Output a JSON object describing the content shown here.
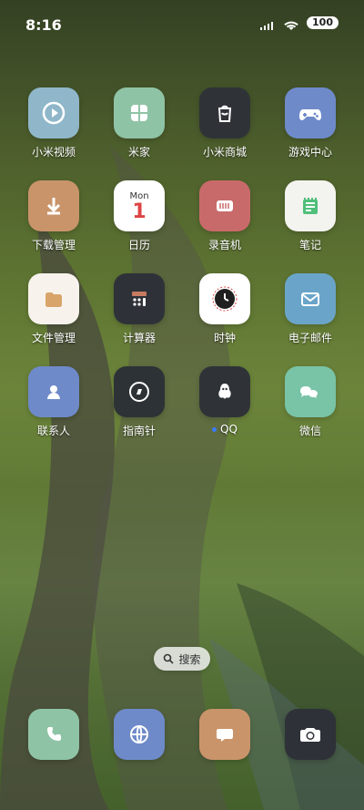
{
  "status_bar": {
    "time": "8:16",
    "battery": "100",
    "icons": [
      "signal-icon",
      "wifi-icon",
      "battery-icon"
    ]
  },
  "apps": [
    {
      "label": "小米视频",
      "icon": "play-icon",
      "color": "#8fb7c9"
    },
    {
      "label": "米家",
      "icon": "home-grid-icon",
      "color": "#8fc3a6"
    },
    {
      "label": "小米商城",
      "icon": "shopping-bag-icon",
      "color": "#2f3338"
    },
    {
      "label": "游戏中心",
      "icon": "gamepad-icon",
      "color": "#6e8ac9"
    },
    {
      "label": "下载管理",
      "icon": "download-icon",
      "color": "#c9946a"
    },
    {
      "label": "日历",
      "icon": "calendar-icon",
      "color": "#ffffff",
      "calendar_day": "Mon",
      "calendar_date": "1"
    },
    {
      "label": "录音机",
      "icon": "recorder-icon",
      "color": "#c96a6a"
    },
    {
      "label": "笔记",
      "icon": "notes-icon",
      "color": "#f3f3ef"
    },
    {
      "label": "文件管理",
      "icon": "folder-icon",
      "color": "#f7f3ec"
    },
    {
      "label": "计算器",
      "icon": "calculator-icon",
      "color": "#2e3238"
    },
    {
      "label": "时钟",
      "icon": "clock-icon",
      "color": "#ffffff"
    },
    {
      "label": "电子邮件",
      "icon": "mail-icon",
      "color": "#6aa5c9"
    },
    {
      "label": "联系人",
      "icon": "contact-icon",
      "color": "#6f8ac9"
    },
    {
      "label": "指南针",
      "icon": "compass-icon",
      "color": "#2d3236"
    },
    {
      "label": "QQ",
      "icon": "penguin-icon",
      "color": "#2f3338",
      "badge_dot": true
    },
    {
      "label": "微信",
      "icon": "chat-bubbles-icon",
      "color": "#79c3a6"
    }
  ],
  "search_label": "搜索",
  "dock": [
    {
      "name": "phone",
      "icon": "phone-icon",
      "color": "#8fc3a6"
    },
    {
      "name": "browser",
      "icon": "globe-icon",
      "color": "#6e8ac9"
    },
    {
      "name": "messages",
      "icon": "message-icon",
      "color": "#c9946a"
    },
    {
      "name": "camera",
      "icon": "camera-icon",
      "color": "#2e3238"
    }
  ]
}
